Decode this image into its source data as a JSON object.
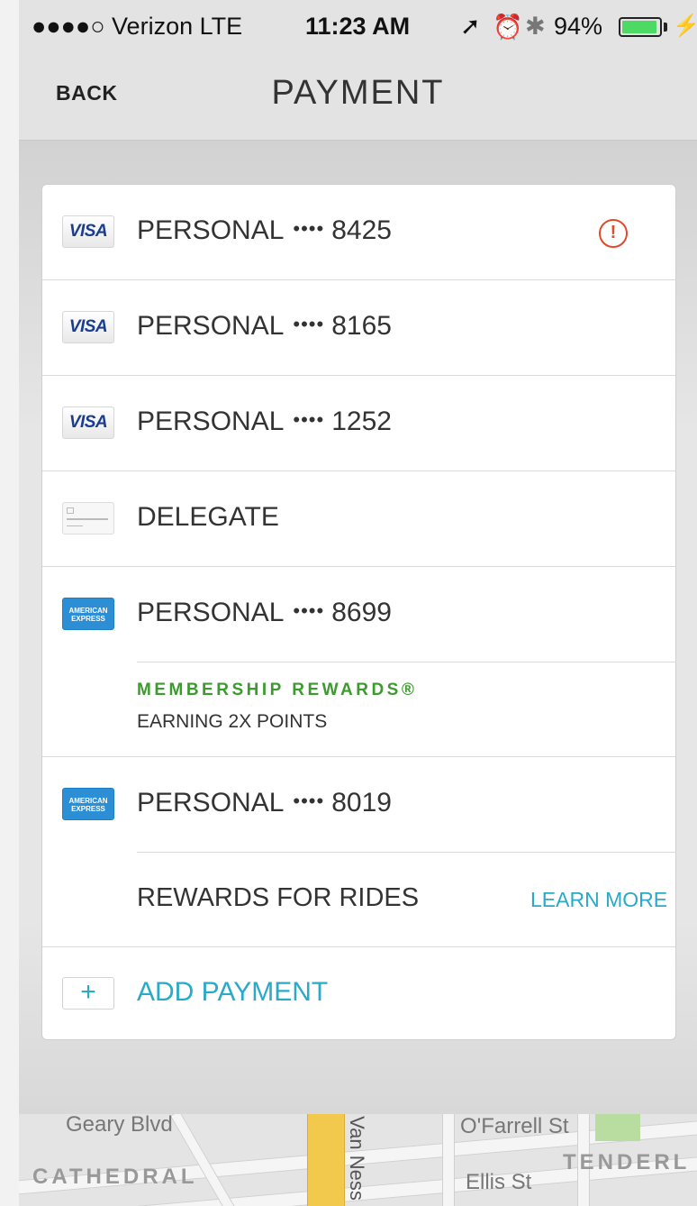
{
  "status_bar": {
    "carrier": "●●●●○ Verizon  LTE",
    "time": "11:23 AM",
    "battery": "94%",
    "battery_level": 0.94
  },
  "nav": {
    "back_label": "BACK",
    "title": "PAYMENT"
  },
  "payment_methods": [
    {
      "card_type": "visa",
      "logo_text": "VISA",
      "label": "PERSONAL",
      "dots": "••••",
      "last4": "8425",
      "alert": true,
      "alert_glyph": "!"
    },
    {
      "card_type": "visa",
      "logo_text": "VISA",
      "label": "PERSONAL",
      "dots": "••••",
      "last4": "8165"
    },
    {
      "card_type": "visa",
      "logo_text": "VISA",
      "label": "PERSONAL",
      "dots": "••••",
      "last4": "1252"
    },
    {
      "card_type": "generic",
      "label": "DELEGATE"
    },
    {
      "card_type": "amex",
      "logo_text": "AMERICAN EXPRESS",
      "label": "PERSONAL",
      "dots": "••••",
      "last4": "8699",
      "program_title": "MEMBERSHIP REWARDS®",
      "program_subtitle": "EARNING 2X POINTS"
    },
    {
      "card_type": "amex",
      "logo_text": "AMERICAN EXPRESS",
      "label": "PERSONAL",
      "dots": "••••",
      "last4": "8019",
      "rewards_label": "REWARDS FOR RIDES",
      "learn_more_label": "LEARN MORE"
    }
  ],
  "add_payment": {
    "plus": "+",
    "label": "ADD PAYMENT"
  },
  "map": {
    "streets": [
      "Geary Blvd",
      "Van Ness",
      "O'Farrell St",
      "Ellis St"
    ],
    "neighborhoods": [
      "CATHEDRAL",
      "TENDERL"
    ]
  },
  "colors": {
    "accent": "#2aa9c9",
    "alert": "#e24a2a",
    "rewards_green": "#3c9a2e",
    "amex_blue": "#2c8fd6",
    "visa_blue": "#1a3d8f"
  }
}
